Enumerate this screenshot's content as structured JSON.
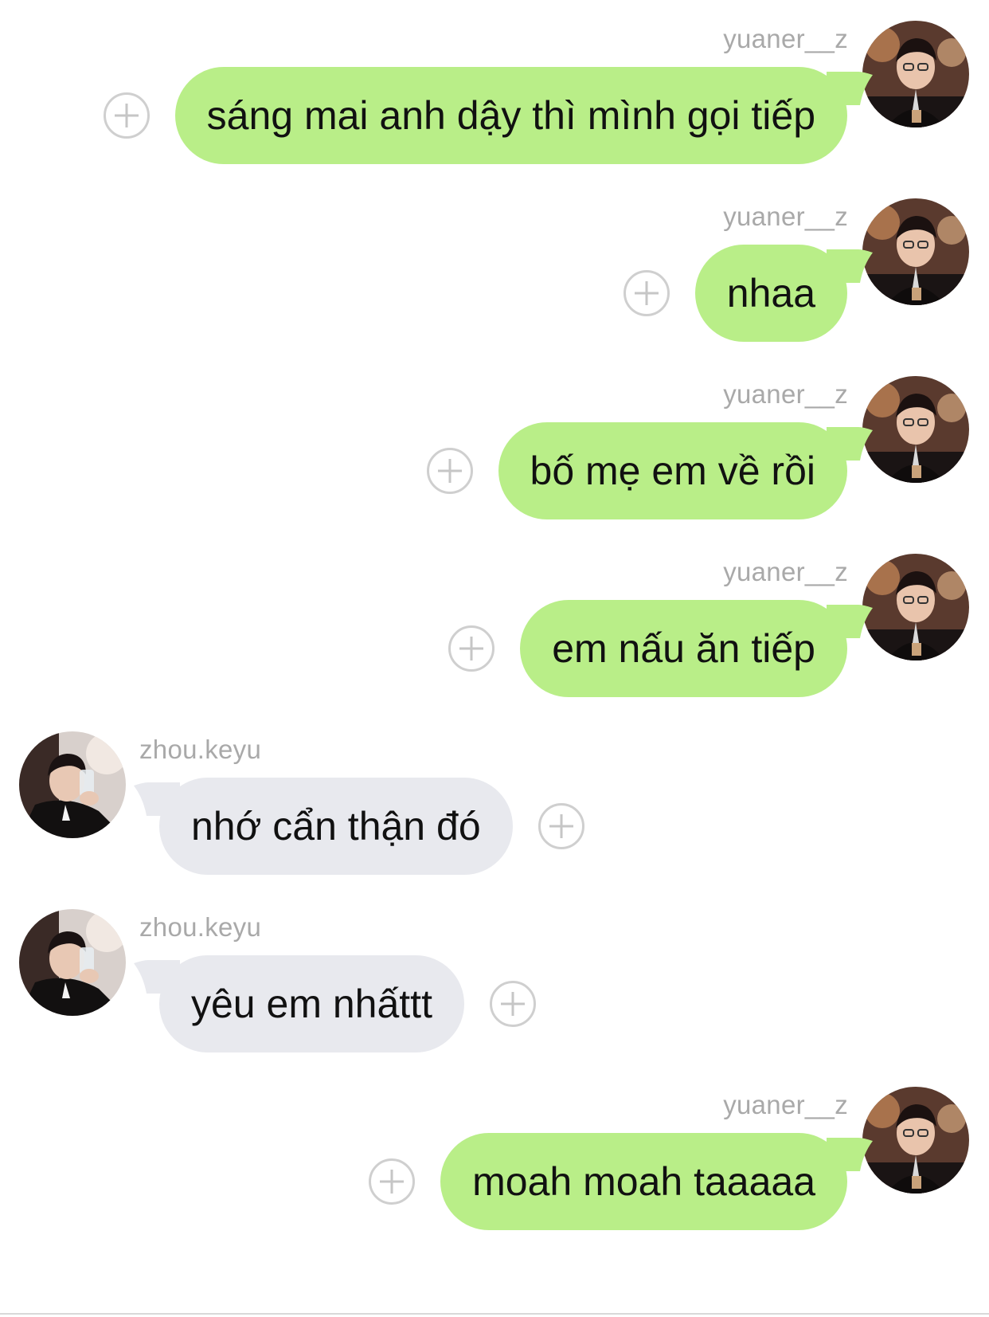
{
  "colors": {
    "outgoing_bubble": "#b9ee88",
    "incoming_bubble": "#e8e9ee",
    "name_text": "#a9a9a9",
    "plus_icon": "#cfcfcf"
  },
  "messages": [
    {
      "sender": "yuaner__z",
      "side": "right",
      "text": "sáng mai anh dậy thì mình gọi tiếp",
      "avatar": "yuaner-avatar-icon"
    },
    {
      "sender": "yuaner__z",
      "side": "right",
      "text": "nhaa",
      "avatar": "yuaner-avatar-icon"
    },
    {
      "sender": "yuaner__z",
      "side": "right",
      "text": "bố mẹ em về rồi",
      "avatar": "yuaner-avatar-icon"
    },
    {
      "sender": "yuaner__z",
      "side": "right",
      "text": "em nấu ăn tiếp",
      "avatar": "yuaner-avatar-icon"
    },
    {
      "sender": "zhou.keyu",
      "side": "left",
      "text": "nhớ cẩn thận đó",
      "avatar": "zhou-avatar-icon"
    },
    {
      "sender": "zhou.keyu",
      "side": "left",
      "text": "yêu em nhấttt",
      "avatar": "zhou-avatar-icon"
    },
    {
      "sender": "yuaner__z",
      "side": "right",
      "text": "moah moah taaaaa",
      "avatar": "yuaner-avatar-icon"
    }
  ]
}
